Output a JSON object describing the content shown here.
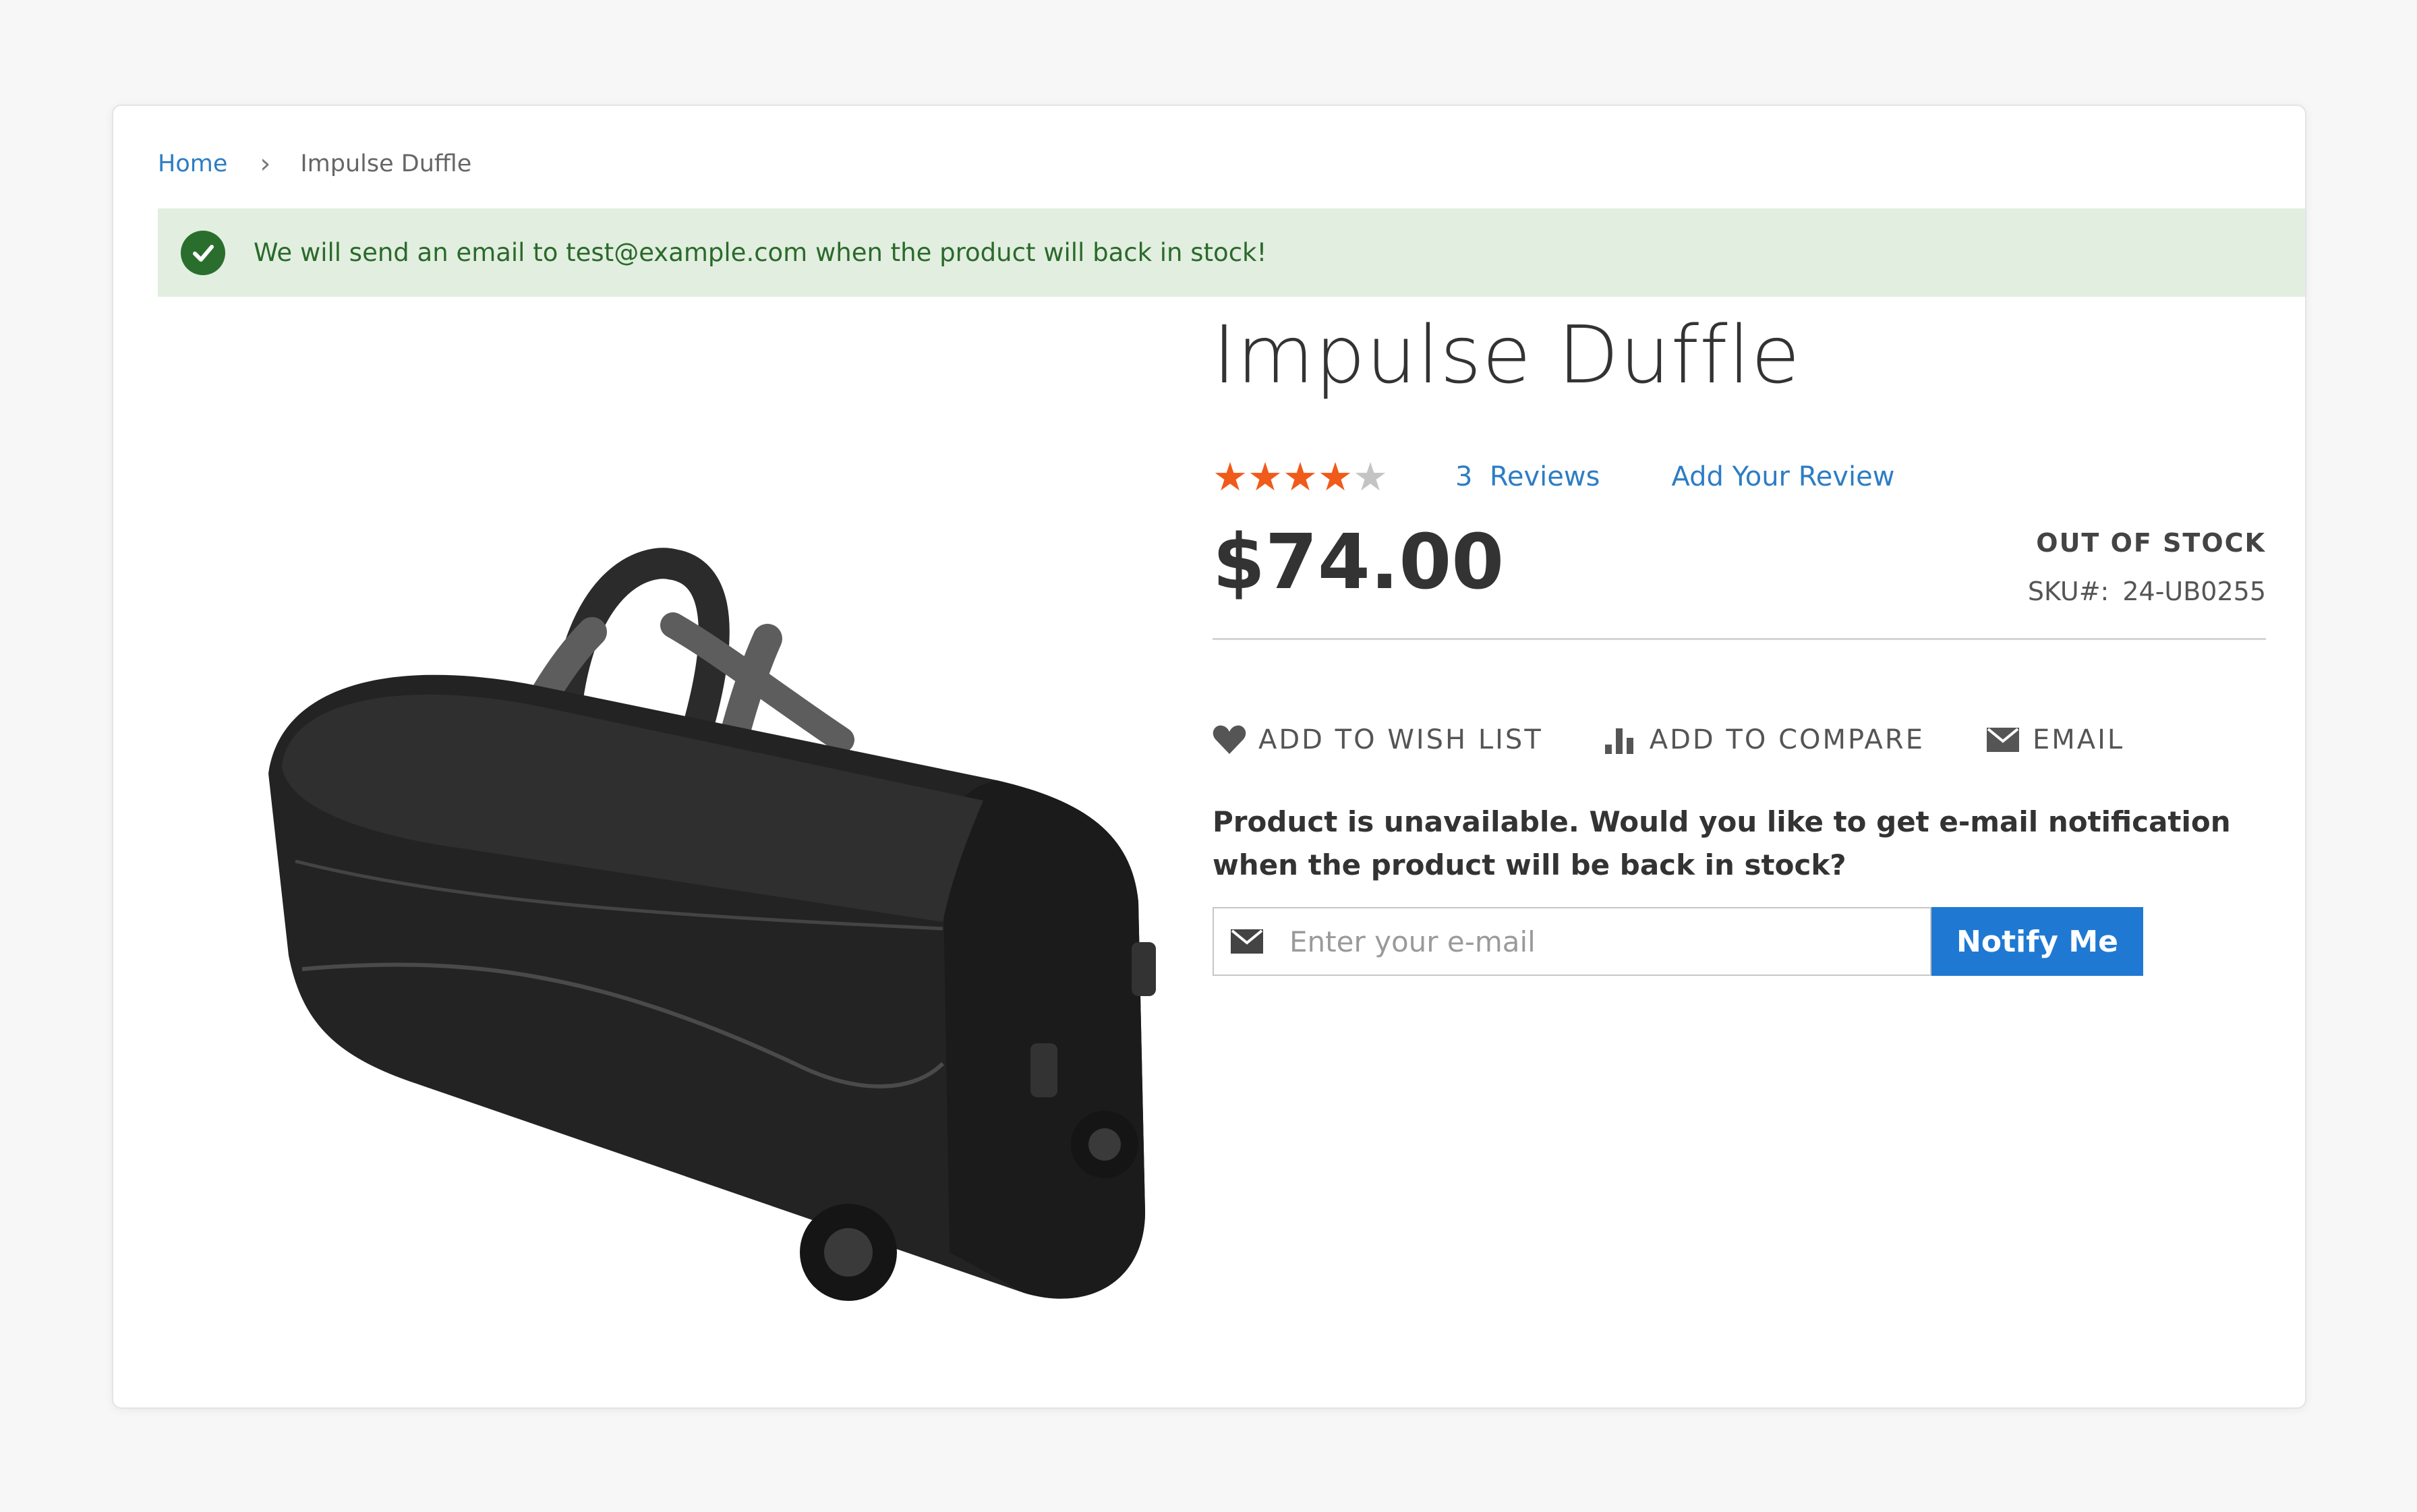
{
  "breadcrumb": {
    "home": "Home",
    "separator": "›",
    "current": "Impulse Duffle"
  },
  "alert": {
    "message": "We will send an email to test@example.com when the product will back in stock!",
    "icon": "check-circle-icon",
    "color": "#2a6e2e",
    "background": "#e2eee0"
  },
  "product": {
    "title": "Impulse Duffle",
    "rating": 4,
    "rating_max": 5,
    "reviews_link": "3  Reviews",
    "add_review_link": "Add Your Review",
    "price": "$74.00",
    "stock_status": "OUT OF STOCK",
    "sku_label": "SKU#:",
    "sku_value": "24-UB0255",
    "image": "black-duffle-bag-image"
  },
  "actions": {
    "wishlist": {
      "label": "ADD TO WISH LIST",
      "icon": "heart-icon"
    },
    "compare": {
      "label": "ADD TO COMPARE",
      "icon": "bar-chart-icon"
    },
    "email": {
      "label": "EMAIL",
      "icon": "envelope-icon"
    }
  },
  "notify": {
    "text": "Product is unavailable. Would you like to get e-mail notification when the product will be back in stock?",
    "placeholder": "Enter your e-mail",
    "button": "Notify Me",
    "button_color": "#1f79d2"
  },
  "colors": {
    "link": "#2d7dc4",
    "star": "#f05a1a",
    "star_empty": "#c4c4c4"
  }
}
